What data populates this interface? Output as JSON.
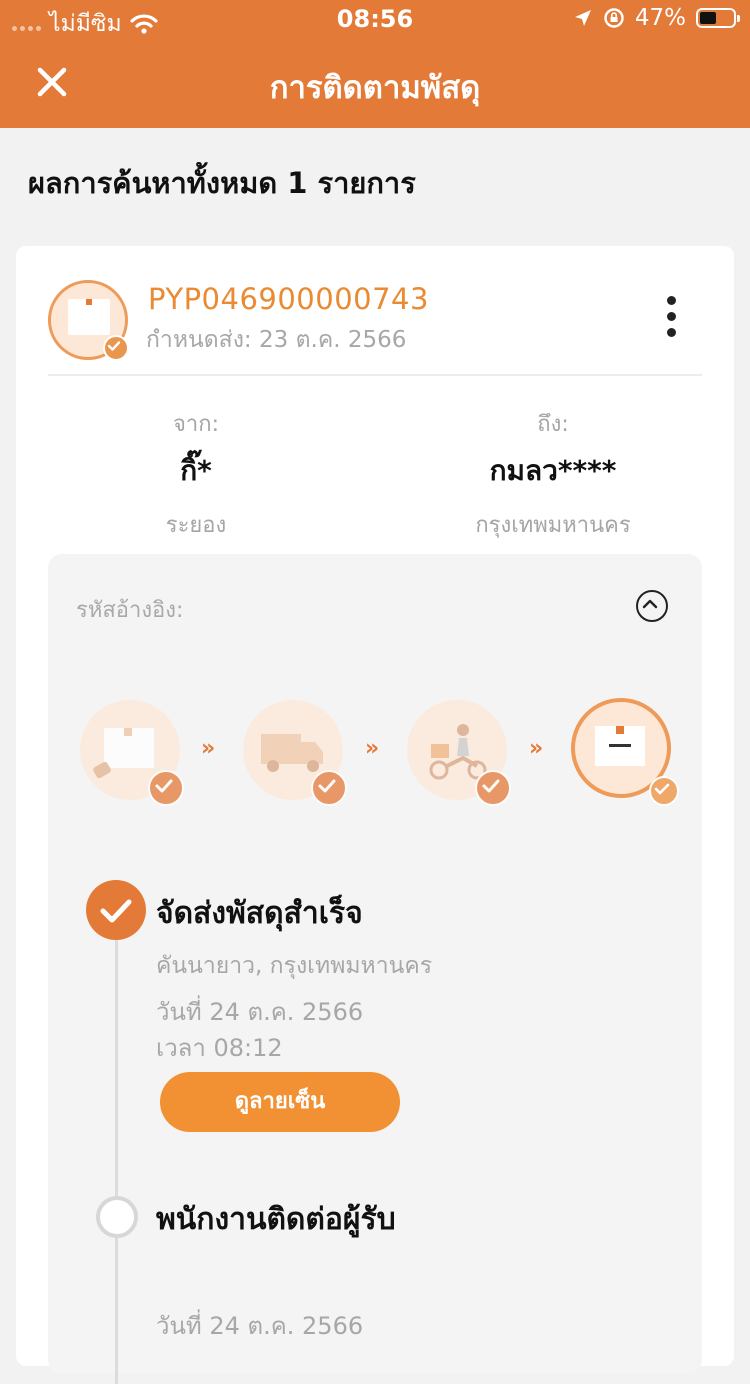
{
  "status_bar": {
    "carrier": "ไม่มีซิม",
    "time": "08:56",
    "battery_percent": "47%"
  },
  "navbar": {
    "title": "การติดตามพัสดุ"
  },
  "results": {
    "count_text": "ผลการค้นหาทั้งหมด 1 รายการ"
  },
  "shipment": {
    "tracking_number": "PYP046900000743",
    "due_date": "กำหนดส่ง: 23 ต.ค. 2566",
    "from": {
      "label": "จาก:",
      "name": "กิ๊*",
      "city": "ระยอง"
    },
    "to": {
      "label": "ถึง:",
      "name": "กมลว****",
      "city": "กรุงเทพมหานคร"
    },
    "reference_label": "รหัสอ้างอิง:",
    "progress_steps": [
      {
        "icon": "package-received-icon",
        "done": true
      },
      {
        "icon": "delivery-truck-icon",
        "done": true
      },
      {
        "icon": "motorcycle-courier-icon",
        "done": true
      },
      {
        "icon": "package-delivered-icon",
        "done": true,
        "current": true
      }
    ],
    "events": [
      {
        "title": "จัดส่งพัสดุสำเร็จ",
        "location": "คันนายาว, กรุงเทพมหานคร",
        "date": "วันที่ 24 ต.ค. 2566",
        "time": "เวลา 08:12",
        "button_label": "ดูลายเซ็น"
      },
      {
        "title": "พนักงานติดต่อผู้รับ",
        "date": "วันที่ 24 ต.ค. 2566"
      }
    ]
  },
  "colors": {
    "brand": "#e47a38",
    "accent_button": "#f19133",
    "tracking_text": "#ea8a32"
  }
}
